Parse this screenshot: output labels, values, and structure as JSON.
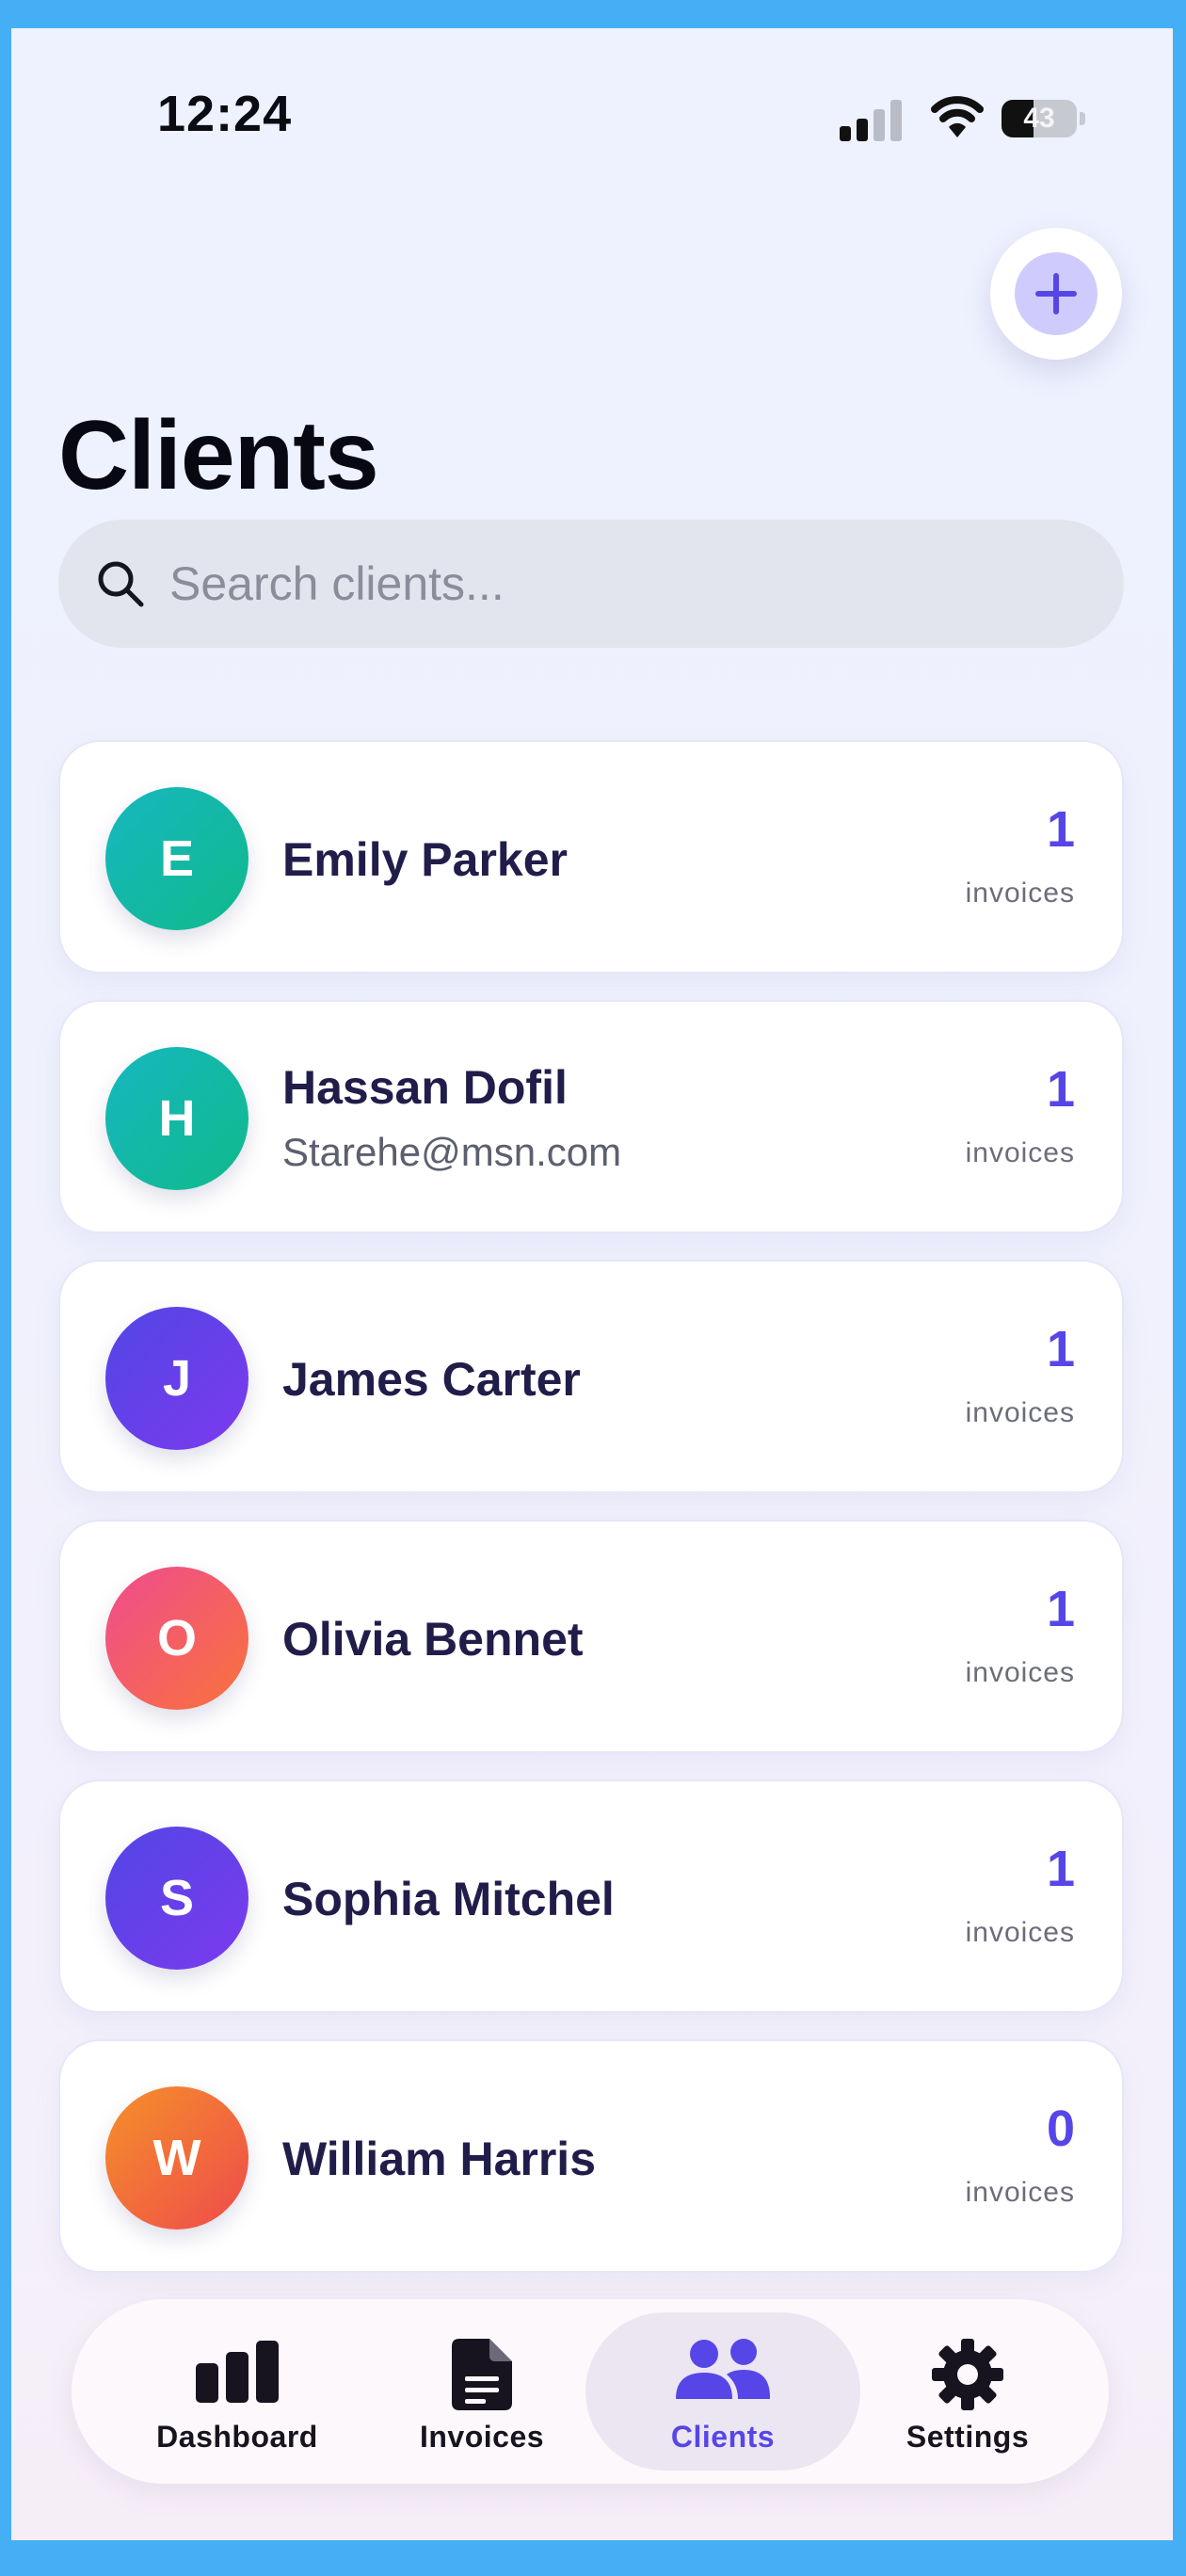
{
  "status_bar": {
    "time": "12:24",
    "battery": "43",
    "battery_level": 0.43,
    "icons": [
      "signal-icon",
      "wifi-icon",
      "battery-icon"
    ]
  },
  "header": {
    "title": "Clients",
    "add_icon": "plus-icon"
  },
  "search": {
    "placeholder": "Search clients...",
    "value": "",
    "icon": "search-icon"
  },
  "clients": [
    {
      "initial": "E",
      "name": "Emily Parker",
      "email": "",
      "count": "1",
      "count_label": "invoices",
      "avatar_gradient": [
        "#16b8c0",
        "#10b98a"
      ]
    },
    {
      "initial": "H",
      "name": "Hassan Dofil",
      "email": "Starehe@msn.com",
      "count": "1",
      "count_label": "invoices",
      "avatar_gradient": [
        "#16b8c0",
        "#10b98a"
      ]
    },
    {
      "initial": "J",
      "name": "James Carter",
      "email": "",
      "count": "1",
      "count_label": "invoices",
      "avatar_gradient": [
        "#5146e6",
        "#7c3aed"
      ]
    },
    {
      "initial": "O",
      "name": "Olivia Bennet",
      "email": "",
      "count": "1",
      "count_label": "invoices",
      "avatar_gradient": [
        "#ef4b8f",
        "#f9733a"
      ]
    },
    {
      "initial": "S",
      "name": "Sophia Mitchel",
      "email": "",
      "count": "1",
      "count_label": "invoices",
      "avatar_gradient": [
        "#5146e6",
        "#7c3aed"
      ]
    },
    {
      "initial": "W",
      "name": "William Harris",
      "email": "",
      "count": "0",
      "count_label": "invoices",
      "avatar_gradient": [
        "#f5902a",
        "#ef4b4b"
      ]
    }
  ],
  "nav": {
    "active": "Clients",
    "items": [
      {
        "label": "Dashboard",
        "icon": "bar-chart-icon"
      },
      {
        "label": "Invoices",
        "icon": "document-icon"
      },
      {
        "label": "Clients",
        "icon": "users-icon"
      },
      {
        "label": "Settings",
        "icon": "gear-icon"
      }
    ]
  },
  "colors": {
    "accent": "#5646e8",
    "frame": "#45aff5",
    "client_name": "#211d4a"
  }
}
